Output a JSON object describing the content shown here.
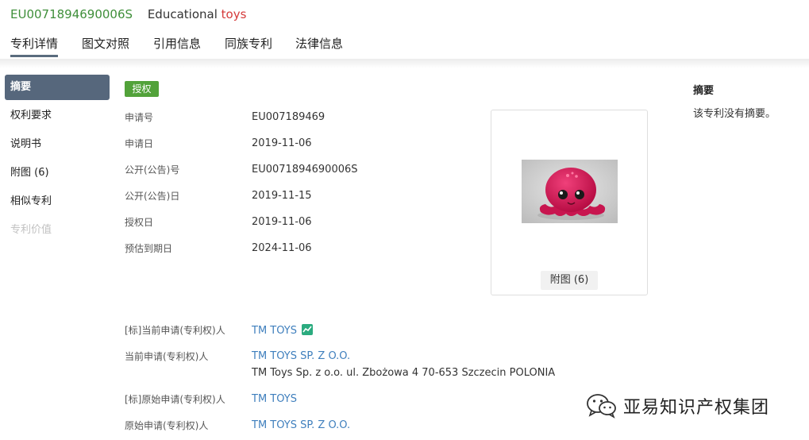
{
  "header": {
    "pub_no": "EU0071894690006S",
    "title_prefix": "Educational",
    "title_highlight": "toys"
  },
  "tabs": [
    {
      "label": "专利详情",
      "active": true
    },
    {
      "label": "图文对照"
    },
    {
      "label": "引用信息"
    },
    {
      "label": "同族专利"
    },
    {
      "label": "法律信息"
    }
  ],
  "sidebar": {
    "items": [
      {
        "label": "摘要",
        "active": true
      },
      {
        "label": "权利要求"
      },
      {
        "label": "说明书"
      },
      {
        "label": "附图 (6)"
      },
      {
        "label": "相似专利"
      },
      {
        "label": "专利价值",
        "disabled": true
      }
    ]
  },
  "status_badge": "授权",
  "fields": [
    {
      "label": "申请号",
      "value": "EU007189469"
    },
    {
      "label": "申请日",
      "value": "2019-11-06"
    },
    {
      "label": "公开(公告)号",
      "value": "EU0071894690006S"
    },
    {
      "label": "公开(公告)日",
      "value": "2019-11-15"
    },
    {
      "label": "授权日",
      "value": "2019-11-06"
    },
    {
      "label": "预估到期日",
      "value": "2024-11-06"
    }
  ],
  "applicants": [
    {
      "label": "[标]当前申请(专利权)人",
      "value": "TM TOYS"
    },
    {
      "label": "当前申请(专利权)人",
      "value": "TM TOYS SP. Z O.O.",
      "address": "TM Toys Sp. z o.o. ul. Zbożowa 4 70-653 Szczecin POLONIA"
    },
    {
      "label": "[标]原始申请(专利权)人",
      "value": "TM TOYS"
    },
    {
      "label": "原始申请(专利权)人",
      "value": "TM TOYS SP. Z O.O."
    }
  ],
  "figure": {
    "button_label": "附图 (6)"
  },
  "abstract": {
    "title": "摘要",
    "text": "该专利没有摘要。"
  },
  "watermark": {
    "text": "亚易知识产权集团"
  },
  "colors": {
    "accent": "#56677c",
    "badge_green": "#52a23a",
    "link_blue": "#3f7fbd",
    "pub_no_green": "#3f8f3a",
    "highlight_red": "#d53a3a"
  }
}
